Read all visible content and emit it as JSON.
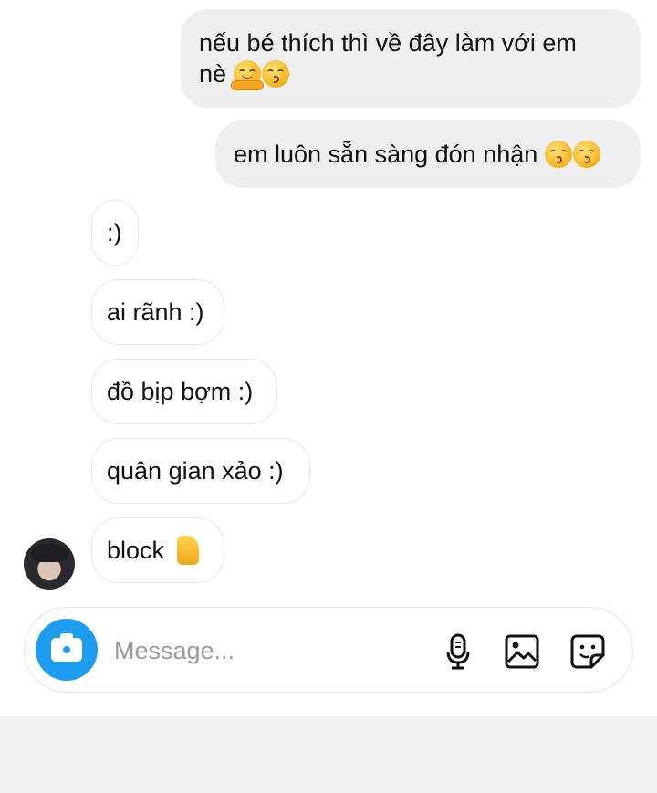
{
  "messages": {
    "sent": [
      {
        "line1": "nếu bé thích thì về đây làm với em",
        "line2": "nè",
        "emojis": [
          "hugging-face",
          "kissing-face"
        ]
      },
      {
        "line1": "em luôn sẵn sàng đón nhận",
        "emojis": [
          "kissing-face",
          "kissing-face"
        ]
      }
    ],
    "received": [
      {
        "text": ":)"
      },
      {
        "text": "ai rãnh :)"
      },
      {
        "text": "đồ bịp bợm :)"
      },
      {
        "text": "quân gian xảo :)"
      },
      {
        "text": "block",
        "emoji": "thumbs-up"
      }
    ]
  },
  "composer": {
    "placeholder": "Message...",
    "value": ""
  },
  "colors": {
    "accent": "#1e9cf0",
    "sent_bubble": "#efefef",
    "received_border": "#e6e6e6",
    "emoji_yellow": "#f7b21a"
  }
}
